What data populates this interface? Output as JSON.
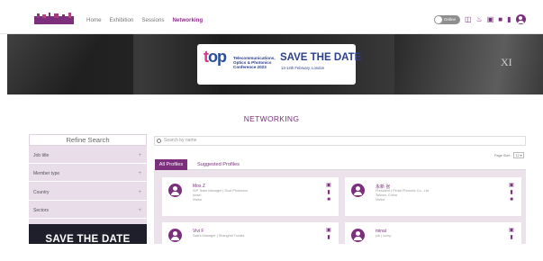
{
  "nav": {
    "items": [
      "Home",
      "Exhibition",
      "Sessions",
      "Networking"
    ],
    "active": "Networking"
  },
  "header_tools": {
    "toggle_label": "Online",
    "icons": [
      "book-icon",
      "bell-icon",
      "calendar-icon",
      "video-icon",
      "chat-icon",
      "user-avatar-icon"
    ]
  },
  "banner": {
    "logo_text": "top",
    "conference": "Telecommunications, Optics & Photonics Conference 2023",
    "headline": "SAVE THE DATE",
    "date": "13-14th February, London",
    "right_mark": "XI"
  },
  "page_title": "NETWORKING",
  "sidebar": {
    "heading": "Refine Search",
    "filters": [
      "Job title",
      "Member type",
      "Country",
      "Sectors"
    ],
    "promo": "SAVE THE DATE"
  },
  "search": {
    "placeholder": "Search by name"
  },
  "page_size": {
    "label": "Page Size :",
    "value": "12"
  },
  "tabs": [
    "All Profiles",
    "Suggested Profiles"
  ],
  "profiles": [
    {
      "name": "Mos Z",
      "title": "SIP Team Manager | Dust Photonics",
      "location": "Israel",
      "role": "Visitor"
    },
    {
      "name": "永新 张",
      "title": "President | Pedal Photonic Co., Ltd",
      "location": "Taiwan, China",
      "role": "Visitor"
    },
    {
      "name": "Vivi F",
      "title": "Sales Manager | Shanghai Tunafa",
      "location": "",
      "role": ""
    },
    {
      "name": "minal",
      "title": "job | comp",
      "location": "",
      "role": ""
    }
  ],
  "colors": {
    "accent": "#7b2f7d",
    "sidebar_bg": "#e9dde9",
    "cards_bg": "#ece2ec"
  }
}
